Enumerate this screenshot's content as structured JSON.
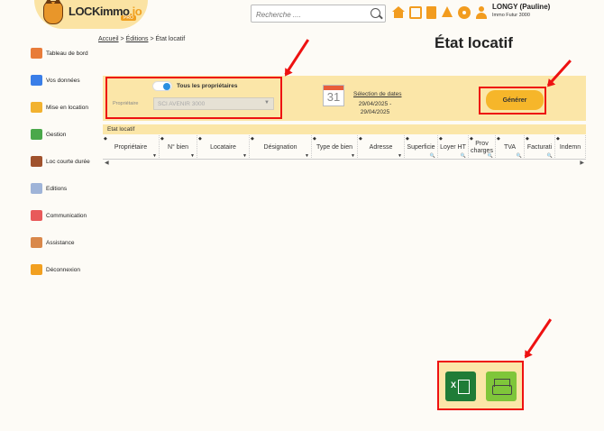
{
  "header": {
    "logo_text": "LOCKimmo",
    "logo_suffix": ".io",
    "logo_badge": "PRO",
    "search_placeholder": "Recherche ....",
    "user_name": "LONGY (Pauline)",
    "user_company": "Immo Futur 3000"
  },
  "sidebar": {
    "items": [
      {
        "label": "Tableau de bord",
        "color": "#e87c3a"
      },
      {
        "label": "Vos données",
        "color": "#3a7ee8"
      },
      {
        "label": "Mise en location",
        "color": "#f2b230"
      },
      {
        "label": "Gestion",
        "color": "#4aa84a"
      },
      {
        "label": "Loc courte durée",
        "color": "#a0522d"
      },
      {
        "label": "Editions",
        "color": "#9fb4d8"
      },
      {
        "label": "Communication",
        "color": "#e85a5a"
      },
      {
        "label": "Assistance",
        "color": "#d9884a"
      },
      {
        "label": "Déconnexion",
        "color": "#f2a020"
      }
    ]
  },
  "breadcrumb": {
    "home": "Accueil",
    "section": "Éditions",
    "current": "État locatif",
    "sep": ">"
  },
  "page": {
    "title": "État locatif"
  },
  "filters": {
    "toggle_label": "Tous les propriétaires",
    "owner_label": "Propriétaire",
    "owner_value": "SCI AVENIR 3000",
    "calendar_day": "31",
    "date_link": "Sélection de dates",
    "date_range": "29/04/2025 - 29/04/2025",
    "generate_label": "Générer"
  },
  "table": {
    "title": "Etat locatif",
    "columns": [
      "Propriétaire",
      "N° bien",
      "Locataire",
      "Désignation",
      "Type de bien",
      "Adresse",
      "Superficie",
      "Loyer HT",
      "Prov charges",
      "TVA",
      "Facturati",
      "Indemn"
    ]
  }
}
